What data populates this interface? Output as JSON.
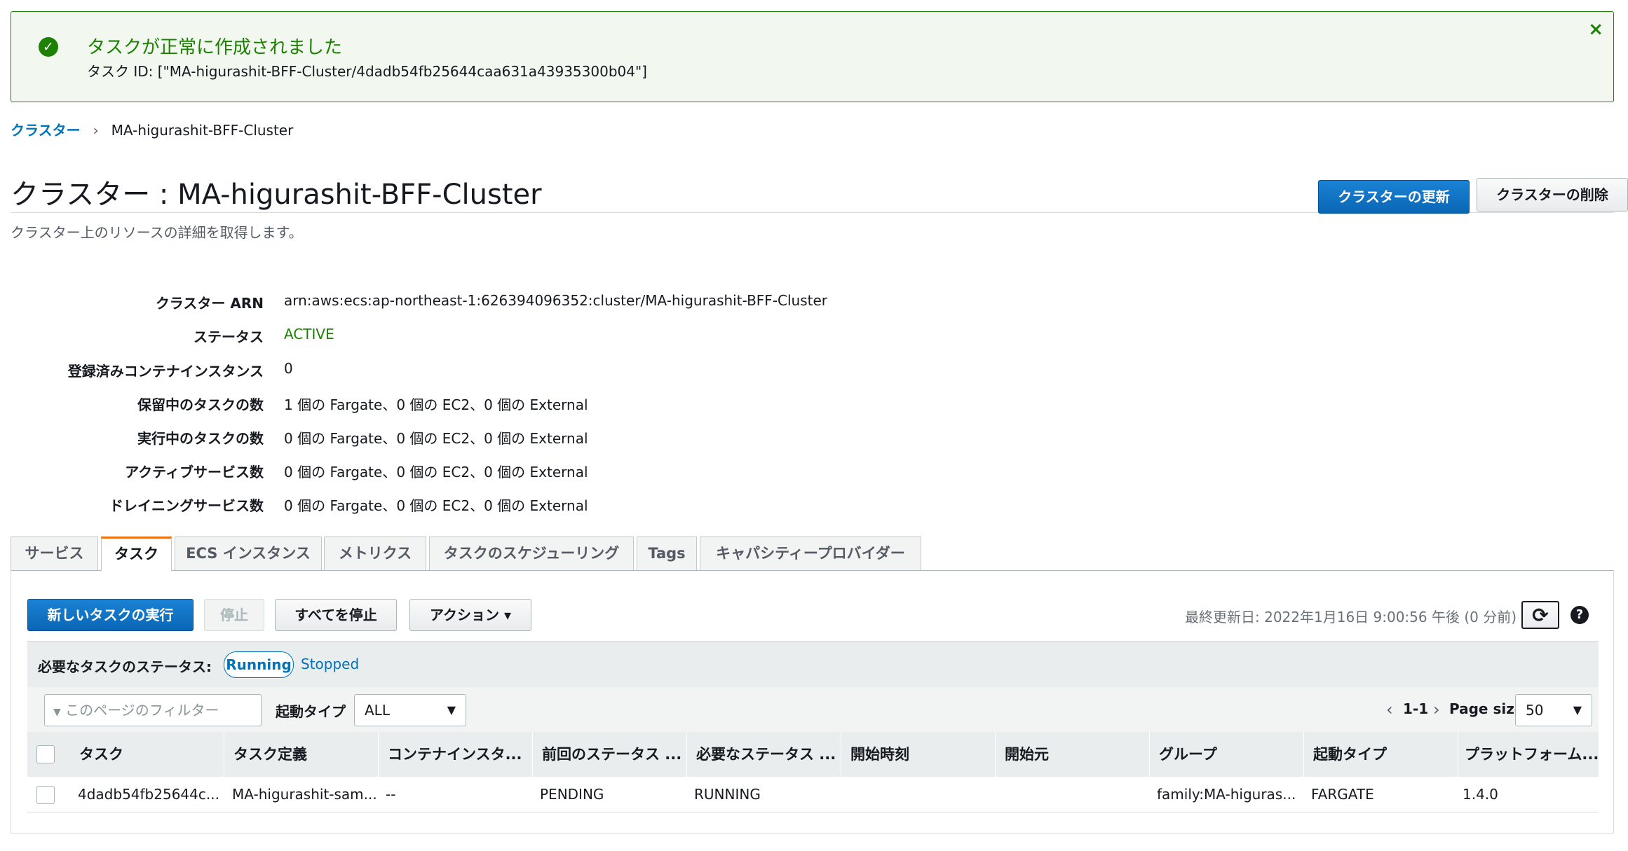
{
  "flash": {
    "title": "タスクが正常に作成されました",
    "detail": "タスク ID: [\"MA-higurashit-BFF-Cluster/4dadb54fb25644caa631a43935300b04\"]",
    "close_icon": "×",
    "color": "#1d8102"
  },
  "breadcrumb": {
    "root": "クラスター",
    "separator": "›",
    "current": "MA-higurashit-BFF-Cluster"
  },
  "header": {
    "title": "クラスター : MA-higurashit-BFF-Cluster",
    "description": "クラスター上のリソースの詳細を取得します。",
    "update_button": "クラスターの更新",
    "delete_button": "クラスターの削除"
  },
  "details": [
    {
      "label": "クラスター ARN",
      "value": "arn:aws:ecs:ap-northeast-1:626394096352:cluster/MA-higurashit-BFF-Cluster"
    },
    {
      "label": "ステータス",
      "value": "ACTIVE"
    },
    {
      "label": "登録済みコンテナインスタンス",
      "value": "0"
    },
    {
      "label": "保留中のタスクの数",
      "value": "1 個の Fargate、0 個の EC2、0 個の External"
    },
    {
      "label": "実行中のタスクの数",
      "value": "0 個の Fargate、0 個の EC2、0 個の External"
    },
    {
      "label": "アクティブサービス数",
      "value": "0 個の Fargate、0 個の EC2、0 個の External"
    },
    {
      "label": "ドレイニングサービス数",
      "value": "0 個の Fargate、0 個の EC2、0 個の External"
    }
  ],
  "tabs": [
    "サービス",
    "タスク",
    "ECS インスタンス",
    "メトリクス",
    "タスクのスケジューリング",
    "Tags",
    "キャパシティープロバイダー"
  ],
  "selected_tab": "タスク",
  "toolbar": {
    "run_task": "新しいタスクの実行",
    "stop": "停止",
    "stop_all": "すべてを停止",
    "actions": "アクション ▾",
    "last_updated": "最終更新日: 2022年1月16日 9:00:56 午後 (0 分前)",
    "refresh_icon": "⟳",
    "help_icon": "?"
  },
  "status_filter": {
    "label": "必要なタスクのステータス:",
    "running": "Running",
    "stopped": "Stopped"
  },
  "filter": {
    "placeholder": "このページのフィルター",
    "filter_icon": "▼",
    "launch_type_label": "起動タイプ",
    "launch_type_value": "ALL",
    "pagination": "1-1",
    "prev_icon": "‹",
    "next_icon": "›",
    "page_size_label": "Page size",
    "page_size_value": "50",
    "caret": "▼"
  },
  "table": {
    "columns": [
      "タスク",
      "タスク定義",
      "コンテナインスタ...",
      "前回のステータス ...",
      "必要なステータス ...",
      "開始時刻",
      "開始元",
      "グループ",
      "起動タイプ",
      "プラットフォーム..."
    ],
    "rows": [
      [
        "4dadb54fb25644c...",
        "MA-higurashit-sam...",
        "--",
        "PENDING",
        "RUNNING",
        "",
        "",
        "family:MA-higuras...",
        "FARGATE",
        "1.4.0"
      ]
    ]
  }
}
